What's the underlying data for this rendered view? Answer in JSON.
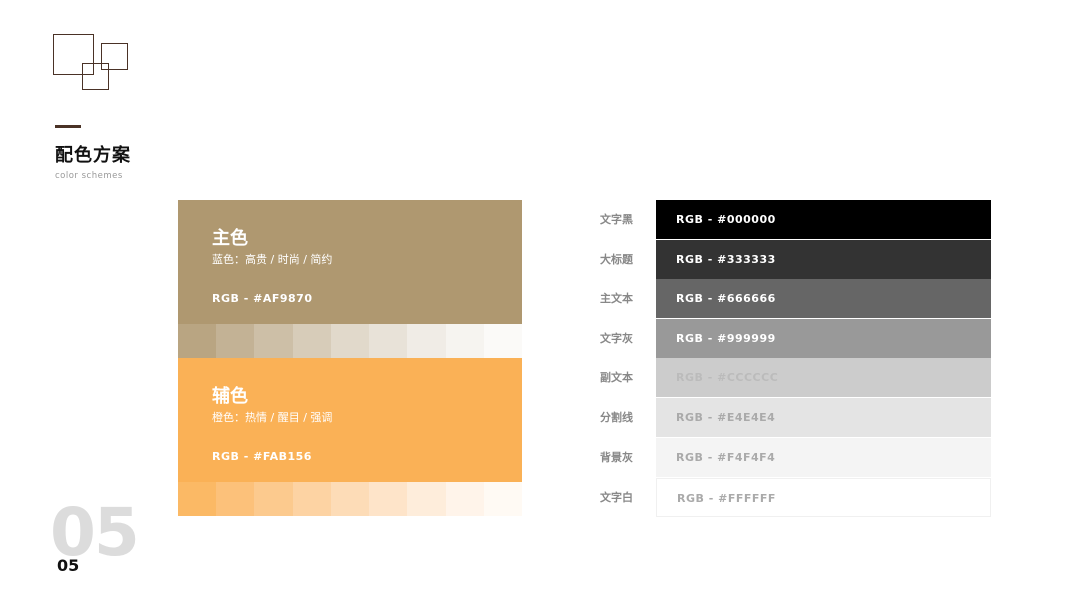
{
  "header": {
    "title": "配色方案",
    "subtitle": "color schemes"
  },
  "page_number": {
    "big": "05",
    "small": "05"
  },
  "main_color": {
    "name": "主色",
    "desc": "蓝色：高贵 / 时尚 / 简约",
    "rgb": "RGB - #AF9870",
    "hex": "#AF9870",
    "tints": [
      "#B9A582",
      "#C3B295",
      "#CDBFA7",
      "#D7CCB9",
      "#E1D9CB",
      "#E8E2D8",
      "#F0ECE6",
      "#F6F4F0",
      "#FBFAF8"
    ]
  },
  "aux_color": {
    "name": "辅色",
    "desc": "橙色：热情 / 醒目 / 强调",
    "rgb": "RGB - #FAB156",
    "hex": "#FAB156",
    "tints": [
      "#FBB965",
      "#FCC17A",
      "#FCCA8E",
      "#FDD3A3",
      "#FDDCB7",
      "#FEE4C9",
      "#FEEDDB",
      "#FFF4EA",
      "#FFFAF4"
    ]
  },
  "grays": [
    {
      "label": "文字黑",
      "rgb": "RGB - #000000",
      "color": "#000000",
      "text_color": "#ffffff"
    },
    {
      "label": "大标题",
      "rgb": "RGB - #333333",
      "color": "#333333",
      "text_color": "#ffffff"
    },
    {
      "label": "主文本",
      "rgb": "RGB - #666666",
      "color": "#666666",
      "text_color": "#ffffff"
    },
    {
      "label": "文字灰",
      "rgb": "RGB - #999999",
      "color": "#999999",
      "text_color": "#ffffff"
    },
    {
      "label": "副文本",
      "rgb": "RGB - #CCCCCC",
      "color": "#CCCCCC",
      "text_color": "#bbbbbb"
    },
    {
      "label": "分割线",
      "rgb": "RGB - #E4E4E4",
      "color": "#E4E4E4",
      "text_color": "#aaaaaa"
    },
    {
      "label": "背景灰",
      "rgb": "RGB - #F4F4F4",
      "color": "#F4F4F4",
      "text_color": "#aaaaaa"
    },
    {
      "label": "文字白",
      "rgb": "RGB - #FFFFFF",
      "color": "#FFFFFF",
      "text_color": "#aaaaaa"
    }
  ]
}
